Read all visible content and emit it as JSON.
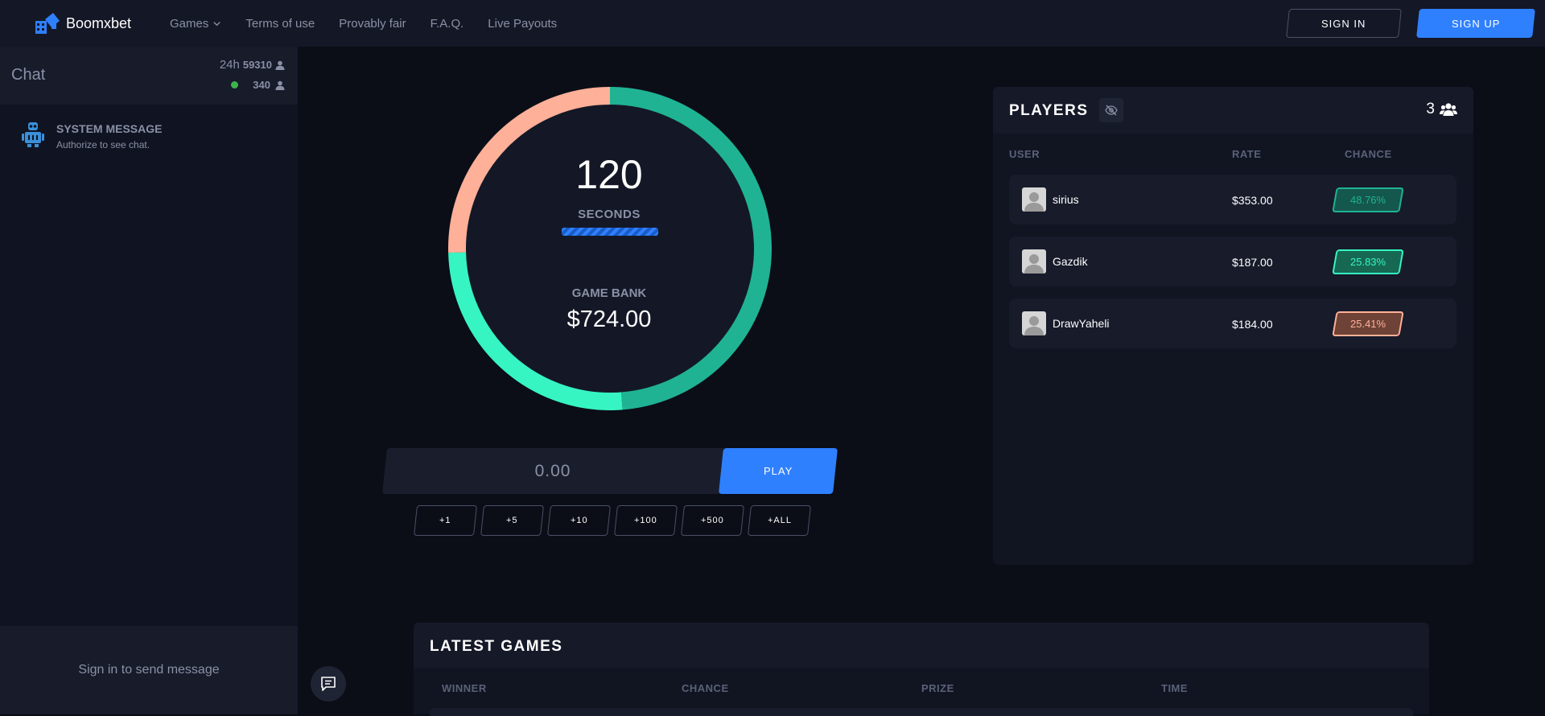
{
  "header": {
    "brand": "Boomxbet",
    "nav": [
      {
        "label": "Games",
        "dropdown": true
      },
      {
        "label": "Terms of use"
      },
      {
        "label": "Provably fair"
      },
      {
        "label": "F.A.Q."
      },
      {
        "label": "Live Payouts"
      }
    ],
    "signin_label": "SIGN IN",
    "signup_label": "SIGN UP"
  },
  "chat": {
    "title": "Chat",
    "period": "24h",
    "users_24h": "59310",
    "online": "340",
    "system_message": {
      "title": "SYSTEM MESSAGE",
      "text": "Authorize to see chat."
    },
    "sign_in_prompt": "Sign in to send message"
  },
  "game": {
    "timer": "120",
    "timer_unit": "SECONDS",
    "bank_label": "GAME BANK",
    "bank_value": "$724.00",
    "progress": 1.0
  },
  "bet": {
    "value": "0.00",
    "play_label": "PLAY",
    "quick": [
      "+1",
      "+5",
      "+10",
      "+100",
      "+500",
      "+ALL"
    ]
  },
  "players": {
    "title": "PLAYERS",
    "count": "3",
    "columns": {
      "user": "USER",
      "rate": "RATE",
      "chance": "CHANCE"
    },
    "rows": [
      {
        "name": "sirius",
        "rate": "$353.00",
        "chance": "48.76%",
        "color": "#1fb394",
        "fill": "#14574c"
      },
      {
        "name": "Gazdik",
        "rate": "$187.00",
        "chance": "25.83%",
        "color": "#36f5c2",
        "fill": "#166853"
      },
      {
        "name": "DrawYaheli",
        "rate": "$184.00",
        "chance": "25.41%",
        "color": "#ffb098",
        "fill": "#6e4236"
      }
    ]
  },
  "latest_games": {
    "title": "LATEST GAMES",
    "columns": [
      "WINNER",
      "CHANCE",
      "PRIZE",
      "TIME"
    ]
  },
  "colors": {
    "accent": "#2f80ff",
    "segment_sirius": "#1fb394",
    "segment_gazdik": "#36f5c2",
    "segment_drawyaheli": "#ffb098"
  }
}
